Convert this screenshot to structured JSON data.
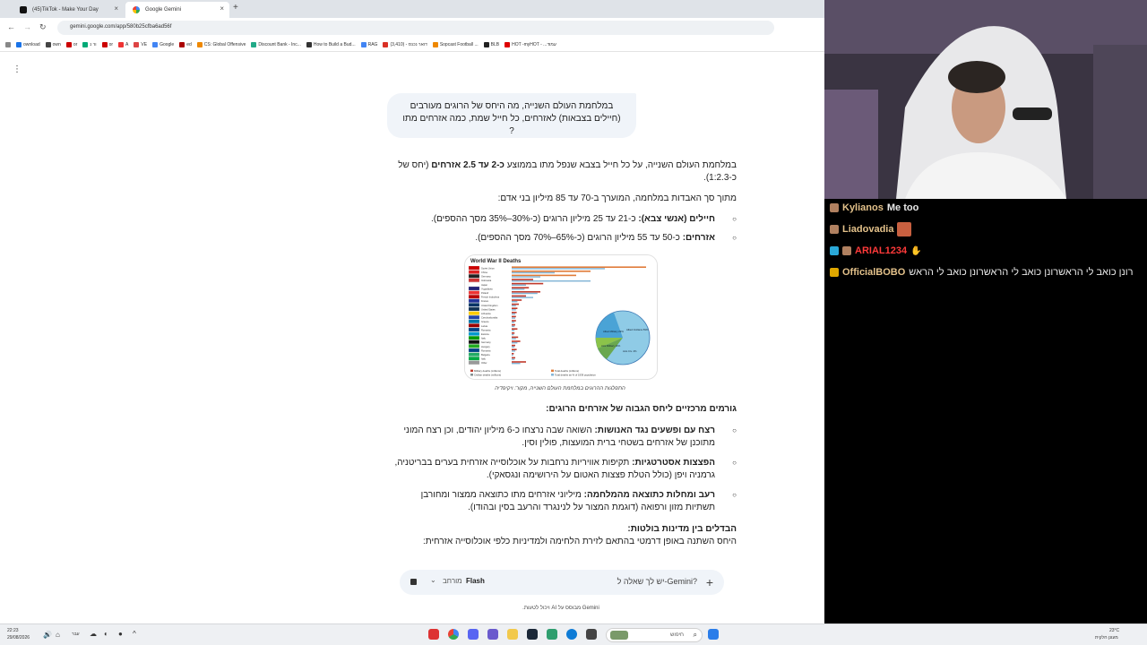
{
  "tabs": [
    {
      "title": "(45)TikTok - Make Your Day",
      "active": false
    },
    {
      "title": "Google Gemini",
      "active": true
    }
  ],
  "address": {
    "url": "gemini.google.com/app/580b25cfba6ad56f"
  },
  "bookmarks": [
    "ownload",
    "own",
    "or",
    "ור נ",
    "or",
    "A",
    "VE",
    "Google",
    "ed",
    "CS: Global Offensive",
    "Discount Bank - Inc...",
    "How to Build a Bud...",
    "RAG",
    "(3,410) - דואר נכנס",
    "Sopcast Football ...",
    "BLB",
    "HOT -myHOT - ...עמוד"
  ],
  "conversation": {
    "user_question": "במלחמת העולם השנייה, מה היחס של הרוגים מעורבים (חיילים בצבאות) לאזרחים, כל חייל שמת, כמה אזרחים מתו ?",
    "intro_a": "במלחמת העולם השנייה, על כל חייל בצבא שנפל מתו בממוצע ",
    "intro_b": "כ-2 עד 2.5 אזרחים",
    "intro_c": " (יחס של כ-1:2.3).",
    "total_line": "מתוך סך האבדות במלחמה, המוערך ב-70 עד 85 מיליון בני אדם:",
    "bullet1_label": "חיילים (אנשי צבא):",
    "bullet1_text": " כ-21 עד 25 מיליון הרוגים (כ-30%–35% מסך ההספים).",
    "bullet2_label": "אזרחים:",
    "bullet2_text": " כ-50 עד 55 מיליון הרוגים (כ-65%–70% מסך ההספים).",
    "image_caption": "התפלגות ההרוגים במלחמת העולם השנייה, מקור: ויקיפדיה",
    "factors_heading": "גורמים מרכזיים ליחס הגבוה של אזרחים הרוגים:",
    "factor1_label": "רצח עם ופשעים נגד האנושות:",
    "factor1_text": " השואה שבה נרצחו כ-6 מיליון יהודים, וכן רצח המוני מתוכנן של אזרחים בשטחי ברית המועצות, פולין וסין.",
    "factor2_label": "הפצצות אסטרטגיות:",
    "factor2_text": " תקיפות אוויריות נרחבות על אוכלוסייה אזרחית בערים בבריטניה, גרמניה ויפן (כולל הטלת פצצות האטום על הירושימה ונגסאקי).",
    "factor3_label": "רעב ומחלות כתוצאה מהמלחמה:",
    "factor3_text": " מיליוני אזרחים מתו כתוצאה ממצור ומחורבן תשתיות מזון ורפואה (דוגמת המצור על לנינגרד והרעב בסין ובהודו).",
    "diffs_heading": "הבדלים בין מדינות בולטות:",
    "diffs_text": "היחס השתנה באופן דרמטי בהתאם לזירת הלחימה ולמדיניות כלפי אוכלוסייה אזרחית:"
  },
  "chart_image": {
    "title": "World War II Deaths",
    "countries": [
      "Soviet Union",
      "China",
      "Germany",
      "Indonesia",
      "Japan",
      "Yugoslavia",
      "Poland",
      "French Indochina",
      "France",
      "United Kingdom",
      "United States",
      "Lithuania",
      "Czechoslovakia",
      "Greece",
      "Latvia",
      "Romania",
      "Estonia",
      "Italy",
      "Germany",
      "Hungary",
      "Romania",
      "Bulgaria",
      "Italy",
      "Other"
    ],
    "pie_labels": [
      "Allied Civilians 59%",
      "Allied Military 29%",
      "Axis Military 10%",
      "Axis Civ. 4%"
    ],
    "legend": [
      "Military deaths (millions)",
      "Total deaths (millions)",
      "Civilian deaths (millions)",
      "Total deaths as % of 1939 population"
    ]
  },
  "composer": {
    "placeholder": "?Gemini-יש לך שאלה ל",
    "model": "Flash",
    "mode": "מורחב"
  },
  "disclaimer": "Gemini מבוסס על AI ויכול לטעות.",
  "chat": [
    {
      "user": "Kylianos",
      "message": "Me too",
      "color": "#e3c18a"
    },
    {
      "user": "Liadovadia",
      "message": "",
      "color": "#e3c18a"
    },
    {
      "user": "ARIAL1234",
      "message": "",
      "color": "#ff3a3a"
    },
    {
      "user": "OfficialBOBO",
      "message": "רונן כואב לי הראשרונן כואב לי הראשרונן כואב לי הראש",
      "color": "#e3c18a"
    }
  ],
  "taskbar": {
    "clock_time": "22:23",
    "clock_date": "29/08/2026",
    "search_placeholder": "חיפוש",
    "weather_temp": "23°C",
    "weather_desc": "מעונן חלקית",
    "lang": "עבר"
  },
  "colors": {
    "accent": "#1a73e8",
    "bubble": "#f0f4f9",
    "chat_bg": "#000000"
  }
}
